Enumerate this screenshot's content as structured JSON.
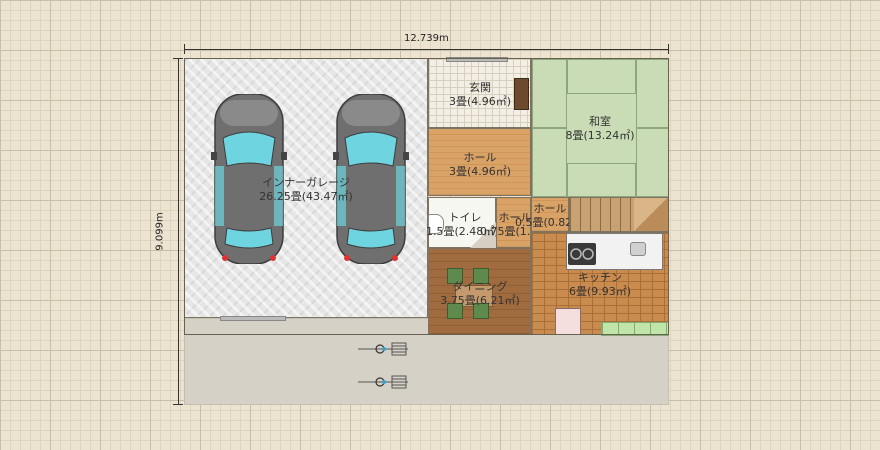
{
  "dimensions": {
    "width_label": "12.739m",
    "height_label": "9.099m"
  },
  "rooms": {
    "garage": {
      "name": "インナーガレージ",
      "size": "26.25畳(43.47㎡)"
    },
    "entrance": {
      "name": "玄関",
      "size": "3畳(4.96㎡)"
    },
    "hall1": {
      "name": "ホール",
      "size": "3畳(4.96㎡)"
    },
    "washitsu": {
      "name": "和室",
      "size": "8畳(13.24㎡)"
    },
    "toilet": {
      "name": "トイレ",
      "size": "1.5畳(2.48㎡)"
    },
    "hall2": {
      "name": "ホール",
      "size": "0.75畳(1.24㎡)"
    },
    "hall3": {
      "name": "ホール",
      "size": "0.5畳(0.82㎡)"
    },
    "dining": {
      "name": "ダイニング",
      "size": "3.75畳(6.21㎡)"
    },
    "kitchen": {
      "name": "キッチン",
      "size": "6畳(9.93㎡)"
    }
  },
  "colors": {
    "car_body": "#6f6f6f",
    "car_glass": "#6ed4e0",
    "tatami": "#c9dcb5",
    "wood_floor": "#d9a267"
  }
}
